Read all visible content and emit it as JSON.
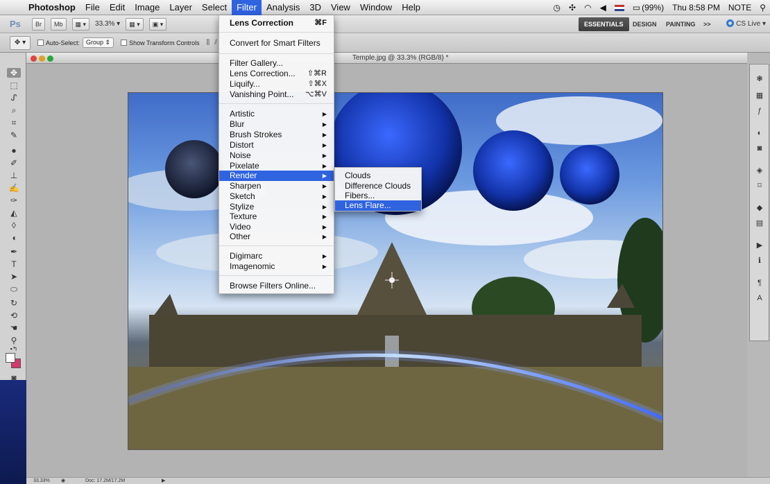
{
  "menubar": {
    "apple_icon": "apple-logo",
    "items": [
      "Photoshop",
      "File",
      "Edit",
      "Image",
      "Layer",
      "Select",
      "Filter",
      "Analysis",
      "3D",
      "View",
      "Window",
      "Help"
    ],
    "active": "Filter",
    "status": {
      "battery": "(99%)",
      "clock": "Thu 8:58 PM",
      "user": "NOTE",
      "search_icon": "magnifier-icon"
    }
  },
  "appbar": {
    "logo": "Ps",
    "zoom": "33.3%",
    "workspaces": [
      "ESSENTIALS",
      "DESIGN",
      "PAINTING"
    ],
    "active_workspace": "ESSENTIALS",
    "more": ">>",
    "cslive": "CS Live"
  },
  "optionsbar": {
    "auto_select_label": "Auto-Select:",
    "auto_select_value": "Group",
    "transform_label": "Show Transform Controls"
  },
  "document": {
    "title": "Temple.jpg @ 33.3% (RGB/8) *"
  },
  "filter_menu": {
    "items": [
      {
        "label": "Lens Correction",
        "shortcut": "⌘F",
        "bold": true
      },
      {
        "label": "Convert for Smart Filters"
      },
      {
        "label": "Filter Gallery..."
      },
      {
        "label": "Lens Correction...",
        "shortcut": "⇧⌘R"
      },
      {
        "label": "Liquify...",
        "shortcut": "⇧⌘X"
      },
      {
        "label": "Vanishing Point...",
        "shortcut": "⌥⌘V"
      },
      {
        "label": "Artistic",
        "submenu": true
      },
      {
        "label": "Blur",
        "submenu": true
      },
      {
        "label": "Brush Strokes",
        "submenu": true
      },
      {
        "label": "Distort",
        "submenu": true
      },
      {
        "label": "Noise",
        "submenu": true
      },
      {
        "label": "Pixelate",
        "submenu": true
      },
      {
        "label": "Render",
        "submenu": true,
        "highlighted": true
      },
      {
        "label": "Sharpen",
        "submenu": true
      },
      {
        "label": "Sketch",
        "submenu": true
      },
      {
        "label": "Stylize",
        "submenu": true
      },
      {
        "label": "Texture",
        "submenu": true
      },
      {
        "label": "Video",
        "submenu": true
      },
      {
        "label": "Other",
        "submenu": true
      },
      {
        "label": "Digimarc",
        "submenu": true
      },
      {
        "label": "Imagenomic",
        "submenu": true
      },
      {
        "label": "Browse Filters Online..."
      }
    ]
  },
  "render_submenu": {
    "items": [
      {
        "label": "Clouds"
      },
      {
        "label": "Difference Clouds"
      },
      {
        "label": "Fibers..."
      },
      {
        "label": "Lens Flare...",
        "highlighted": true
      }
    ]
  },
  "statusbar": {
    "zoom": "33.33%",
    "doc_size": "Doc: 17.2M/17.2M"
  },
  "colors": {
    "menu_highlight": "#2f63e0",
    "foreground": "#ffffff",
    "background": "#d23a6c"
  }
}
